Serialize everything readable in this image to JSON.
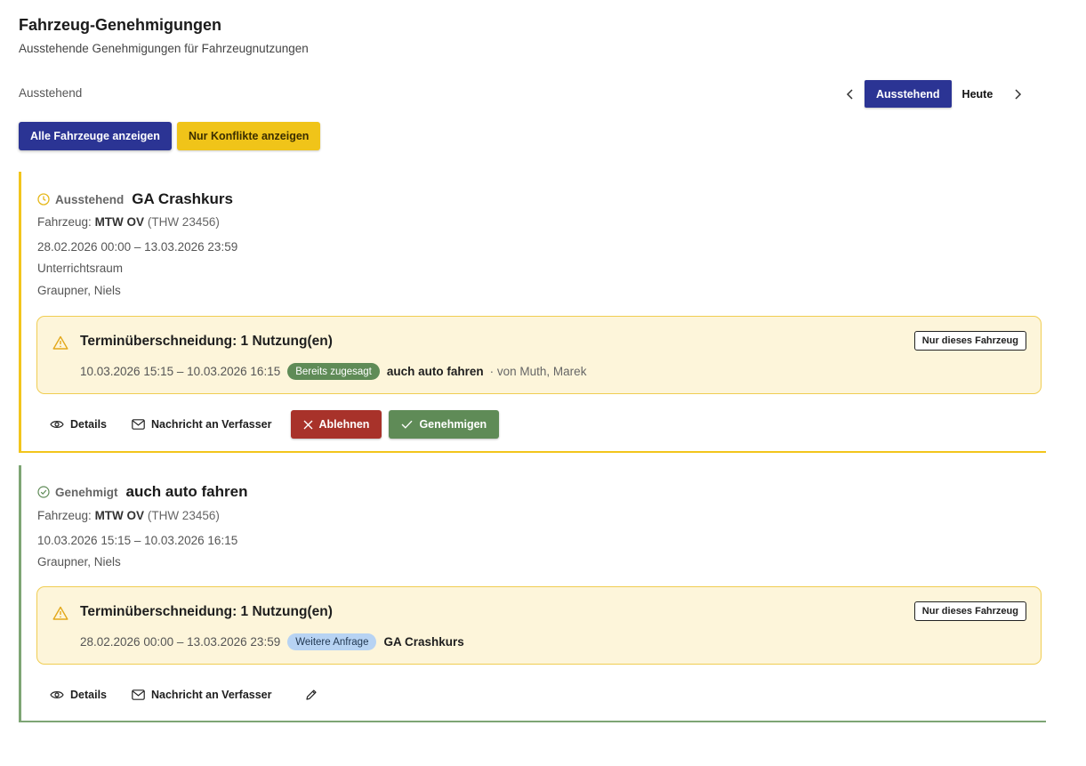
{
  "header": {
    "title": "Fahrzeug-Genehmigungen",
    "subtitle": "Ausstehende Genehmigungen für Fahrzeugnutzungen"
  },
  "filter": {
    "label": "Ausstehend",
    "nav_active": "Ausstehend",
    "nav_today": "Heute"
  },
  "toolbar": {
    "all_vehicles": "Alle Fahrzeuge anzeigen",
    "only_conflicts": "Nur Konflikte anzeigen"
  },
  "colors": {
    "primary": "#2b3494",
    "warning": "#f0c419",
    "success": "#5f8b57",
    "danger": "#a8322a",
    "conflict_bg": "#fdf5da"
  },
  "cards": [
    {
      "status": "Ausstehend",
      "status_icon": "clock-icon",
      "title": "GA Crashkurs",
      "vehicle_label": "Fahrzeug:",
      "vehicle_name": "MTW OV",
      "vehicle_code": "(THW 23456)",
      "time_range": "28.02.2026 00:00 – 13.03.2026 23:59",
      "location": "Unterrichtsraum",
      "person": "Graupner, Niels",
      "conflict": {
        "title": "Terminüberschneidung: 1 Nutzung(en)",
        "only_vehicle_label": "Nur dieses Fahrzeug",
        "range": "10.03.2026 15:15 – 10.03.2026 16:15",
        "badge": "Bereits zugesagt",
        "name": "auch auto fahren",
        "by": "· von Muth, Marek"
      },
      "actions": {
        "details": "Details",
        "message": "Nachricht an Verfasser",
        "reject": "Ablehnen",
        "approve": "Genehmigen"
      }
    },
    {
      "status": "Genehmigt",
      "status_icon": "check-circle-icon",
      "title": "auch auto fahren",
      "vehicle_label": "Fahrzeug:",
      "vehicle_name": "MTW OV",
      "vehicle_code": "(THW 23456)",
      "time_range": "10.03.2026 15:15 – 10.03.2026 16:15",
      "person": "Graupner, Niels",
      "conflict": {
        "title": "Terminüberschneidung: 1 Nutzung(en)",
        "only_vehicle_label": "Nur dieses Fahrzeug",
        "range": "28.02.2026 00:00 – 13.03.2026 23:59",
        "badge": "Weitere Anfrage",
        "name": "GA Crashkurs"
      },
      "actions": {
        "details": "Details",
        "message": "Nachricht an Verfasser"
      }
    }
  ]
}
